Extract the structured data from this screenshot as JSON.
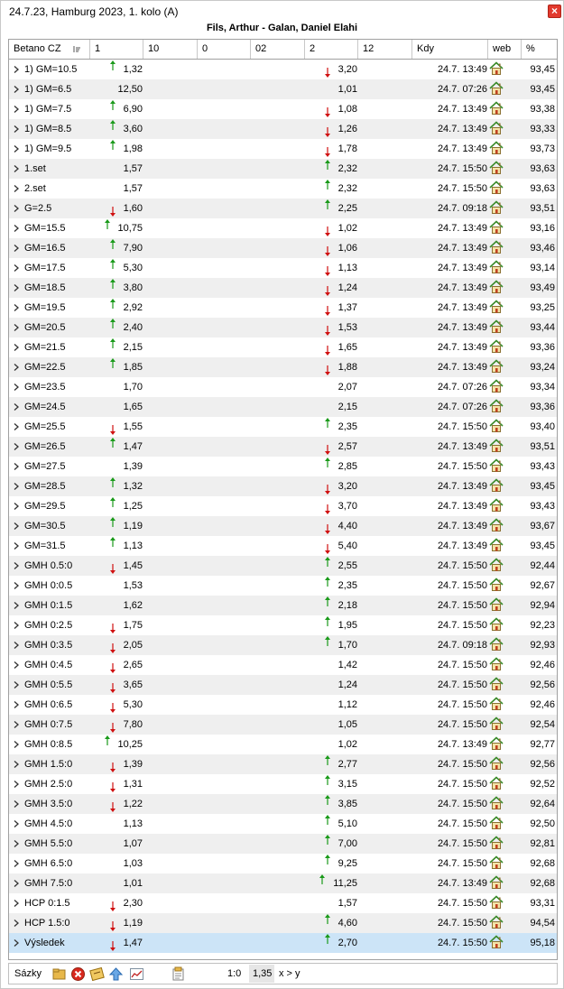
{
  "window": {
    "title": "24.7.23, Hamburg 2023, 1. kolo (A)",
    "close_label": "×"
  },
  "match_title": "Fils, Arthur - Galan, Daniel Elahi",
  "columns": [
    {
      "label": "Betano CZ"
    },
    {
      "label": "1"
    },
    {
      "label": "10"
    },
    {
      "label": "0"
    },
    {
      "label": "02"
    },
    {
      "label": "2"
    },
    {
      "label": "12"
    },
    {
      "label": "Kdy"
    },
    {
      "label": "web"
    },
    {
      "label": "%"
    }
  ],
  "rows": [
    {
      "name": "1) GM=10.5",
      "odd1": "1,32",
      "trend1": "up",
      "odd2": "3,20",
      "trend2": "down",
      "time": "24.7. 13:49",
      "pct": "93,45"
    },
    {
      "name": "1) GM=6.5",
      "odd1": "12,50",
      "trend1": "",
      "odd2": "1,01",
      "trend2": "",
      "time": "24.7. 07:26",
      "pct": "93,45"
    },
    {
      "name": "1) GM=7.5",
      "odd1": "6,90",
      "trend1": "up",
      "odd2": "1,08",
      "trend2": "down",
      "time": "24.7. 13:49",
      "pct": "93,38"
    },
    {
      "name": "1) GM=8.5",
      "odd1": "3,60",
      "trend1": "up",
      "odd2": "1,26",
      "trend2": "down",
      "time": "24.7. 13:49",
      "pct": "93,33"
    },
    {
      "name": "1) GM=9.5",
      "odd1": "1,98",
      "trend1": "up",
      "odd2": "1,78",
      "trend2": "down",
      "time": "24.7. 13:49",
      "pct": "93,73"
    },
    {
      "name": "1.set",
      "odd1": "1,57",
      "trend1": "",
      "odd2": "2,32",
      "trend2": "up",
      "time": "24.7. 15:50",
      "pct": "93,63"
    },
    {
      "name": "2.set",
      "odd1": "1,57",
      "trend1": "",
      "odd2": "2,32",
      "trend2": "up",
      "time": "24.7. 15:50",
      "pct": "93,63"
    },
    {
      "name": "G=2.5",
      "odd1": "1,60",
      "trend1": "down",
      "odd2": "2,25",
      "trend2": "up",
      "time": "24.7. 09:18",
      "pct": "93,51"
    },
    {
      "name": "GM=15.5",
      "odd1": "10,75",
      "trend1": "up",
      "odd2": "1,02",
      "trend2": "down",
      "time": "24.7. 13:49",
      "pct": "93,16"
    },
    {
      "name": "GM=16.5",
      "odd1": "7,90",
      "trend1": "up",
      "odd2": "1,06",
      "trend2": "down",
      "time": "24.7. 13:49",
      "pct": "93,46"
    },
    {
      "name": "GM=17.5",
      "odd1": "5,30",
      "trend1": "up",
      "odd2": "1,13",
      "trend2": "down",
      "time": "24.7. 13:49",
      "pct": "93,14"
    },
    {
      "name": "GM=18.5",
      "odd1": "3,80",
      "trend1": "up",
      "odd2": "1,24",
      "trend2": "down",
      "time": "24.7. 13:49",
      "pct": "93,49"
    },
    {
      "name": "GM=19.5",
      "odd1": "2,92",
      "trend1": "up",
      "odd2": "1,37",
      "trend2": "down",
      "time": "24.7. 13:49",
      "pct": "93,25"
    },
    {
      "name": "GM=20.5",
      "odd1": "2,40",
      "trend1": "up",
      "odd2": "1,53",
      "trend2": "down",
      "time": "24.7. 13:49",
      "pct": "93,44"
    },
    {
      "name": "GM=21.5",
      "odd1": "2,15",
      "trend1": "up",
      "odd2": "1,65",
      "trend2": "down",
      "time": "24.7. 13:49",
      "pct": "93,36"
    },
    {
      "name": "GM=22.5",
      "odd1": "1,85",
      "trend1": "up",
      "odd2": "1,88",
      "trend2": "down",
      "time": "24.7. 13:49",
      "pct": "93,24"
    },
    {
      "name": "GM=23.5",
      "odd1": "1,70",
      "trend1": "",
      "odd2": "2,07",
      "trend2": "",
      "time": "24.7. 07:26",
      "pct": "93,34"
    },
    {
      "name": "GM=24.5",
      "odd1": "1,65",
      "trend1": "",
      "odd2": "2,15",
      "trend2": "",
      "time": "24.7. 07:26",
      "pct": "93,36"
    },
    {
      "name": "GM=25.5",
      "odd1": "1,55",
      "trend1": "down",
      "odd2": "2,35",
      "trend2": "up",
      "time": "24.7. 15:50",
      "pct": "93,40"
    },
    {
      "name": "GM=26.5",
      "odd1": "1,47",
      "trend1": "up",
      "odd2": "2,57",
      "trend2": "down",
      "time": "24.7. 13:49",
      "pct": "93,51"
    },
    {
      "name": "GM=27.5",
      "odd1": "1,39",
      "trend1": "",
      "odd2": "2,85",
      "trend2": "up",
      "time": "24.7. 15:50",
      "pct": "93,43"
    },
    {
      "name": "GM=28.5",
      "odd1": "1,32",
      "trend1": "up",
      "odd2": "3,20",
      "trend2": "down",
      "time": "24.7. 13:49",
      "pct": "93,45"
    },
    {
      "name": "GM=29.5",
      "odd1": "1,25",
      "trend1": "up",
      "odd2": "3,70",
      "trend2": "down",
      "time": "24.7. 13:49",
      "pct": "93,43"
    },
    {
      "name": "GM=30.5",
      "odd1": "1,19",
      "trend1": "up",
      "odd2": "4,40",
      "trend2": "down",
      "time": "24.7. 13:49",
      "pct": "93,67"
    },
    {
      "name": "GM=31.5",
      "odd1": "1,13",
      "trend1": "up",
      "odd2": "5,40",
      "trend2": "down",
      "time": "24.7. 13:49",
      "pct": "93,45"
    },
    {
      "name": "GMH 0.5:0",
      "odd1": "1,45",
      "trend1": "down",
      "odd2": "2,55",
      "trend2": "up",
      "time": "24.7. 15:50",
      "pct": "92,44"
    },
    {
      "name": "GMH 0:0.5",
      "odd1": "1,53",
      "trend1": "",
      "odd2": "2,35",
      "trend2": "up",
      "time": "24.7. 15:50",
      "pct": "92,67"
    },
    {
      "name": "GMH 0:1.5",
      "odd1": "1,62",
      "trend1": "",
      "odd2": "2,18",
      "trend2": "up",
      "time": "24.7. 15:50",
      "pct": "92,94"
    },
    {
      "name": "GMH 0:2.5",
      "odd1": "1,75",
      "trend1": "down",
      "odd2": "1,95",
      "trend2": "up",
      "time": "24.7. 15:50",
      "pct": "92,23"
    },
    {
      "name": "GMH 0:3.5",
      "odd1": "2,05",
      "trend1": "down",
      "odd2": "1,70",
      "trend2": "up",
      "time": "24.7. 09:18",
      "pct": "92,93"
    },
    {
      "name": "GMH 0:4.5",
      "odd1": "2,65",
      "trend1": "down",
      "odd2": "1,42",
      "trend2": "",
      "time": "24.7. 15:50",
      "pct": "92,46"
    },
    {
      "name": "GMH 0:5.5",
      "odd1": "3,65",
      "trend1": "down",
      "odd2": "1,24",
      "trend2": "",
      "time": "24.7. 15:50",
      "pct": "92,56"
    },
    {
      "name": "GMH 0:6.5",
      "odd1": "5,30",
      "trend1": "down",
      "odd2": "1,12",
      "trend2": "",
      "time": "24.7. 15:50",
      "pct": "92,46"
    },
    {
      "name": "GMH 0:7.5",
      "odd1": "7,80",
      "trend1": "down",
      "odd2": "1,05",
      "trend2": "",
      "time": "24.7. 15:50",
      "pct": "92,54"
    },
    {
      "name": "GMH 0:8.5",
      "odd1": "10,25",
      "trend1": "up",
      "odd2": "1,02",
      "trend2": "",
      "time": "24.7. 13:49",
      "pct": "92,77"
    },
    {
      "name": "GMH 1.5:0",
      "odd1": "1,39",
      "trend1": "down",
      "odd2": "2,77",
      "trend2": "up",
      "time": "24.7. 15:50",
      "pct": "92,56"
    },
    {
      "name": "GMH 2.5:0",
      "odd1": "1,31",
      "trend1": "down",
      "odd2": "3,15",
      "trend2": "up",
      "time": "24.7. 15:50",
      "pct": "92,52"
    },
    {
      "name": "GMH 3.5:0",
      "odd1": "1,22",
      "trend1": "down",
      "odd2": "3,85",
      "trend2": "up",
      "time": "24.7. 15:50",
      "pct": "92,64"
    },
    {
      "name": "GMH 4.5:0",
      "odd1": "1,13",
      "trend1": "",
      "odd2": "5,10",
      "trend2": "up",
      "time": "24.7. 15:50",
      "pct": "92,50"
    },
    {
      "name": "GMH 5.5:0",
      "odd1": "1,07",
      "trend1": "",
      "odd2": "7,00",
      "trend2": "up",
      "time": "24.7. 15:50",
      "pct": "92,81"
    },
    {
      "name": "GMH 6.5:0",
      "odd1": "1,03",
      "trend1": "",
      "odd2": "9,25",
      "trend2": "up",
      "time": "24.7. 15:50",
      "pct": "92,68"
    },
    {
      "name": "GMH 7.5:0",
      "odd1": "1,01",
      "trend1": "",
      "odd2": "11,25",
      "trend2": "up",
      "time": "24.7. 13:49",
      "pct": "92,68"
    },
    {
      "name": "HCP 0:1.5",
      "odd1": "2,30",
      "trend1": "down",
      "odd2": "1,57",
      "trend2": "",
      "time": "24.7. 15:50",
      "pct": "93,31"
    },
    {
      "name": "HCP 1.5:0",
      "odd1": "1,19",
      "trend1": "down",
      "odd2": "4,60",
      "trend2": "up",
      "time": "24.7. 15:50",
      "pct": "94,54"
    },
    {
      "name": "Výsledek",
      "odd1": "1,47",
      "trend1": "down",
      "odd2": "2,70",
      "trend2": "up",
      "time": "24.7. 15:50",
      "pct": "95,18",
      "selected": true
    }
  ],
  "footer": {
    "bets_label": "Sázky",
    "score": "1:0",
    "odd": "1,35",
    "condition": "x > y"
  },
  "colors": {
    "up": "#1a9a1a",
    "down": "#d01010",
    "selected": "#cce4f7",
    "alt_row": "#efefef",
    "close": "#e23a2e"
  }
}
